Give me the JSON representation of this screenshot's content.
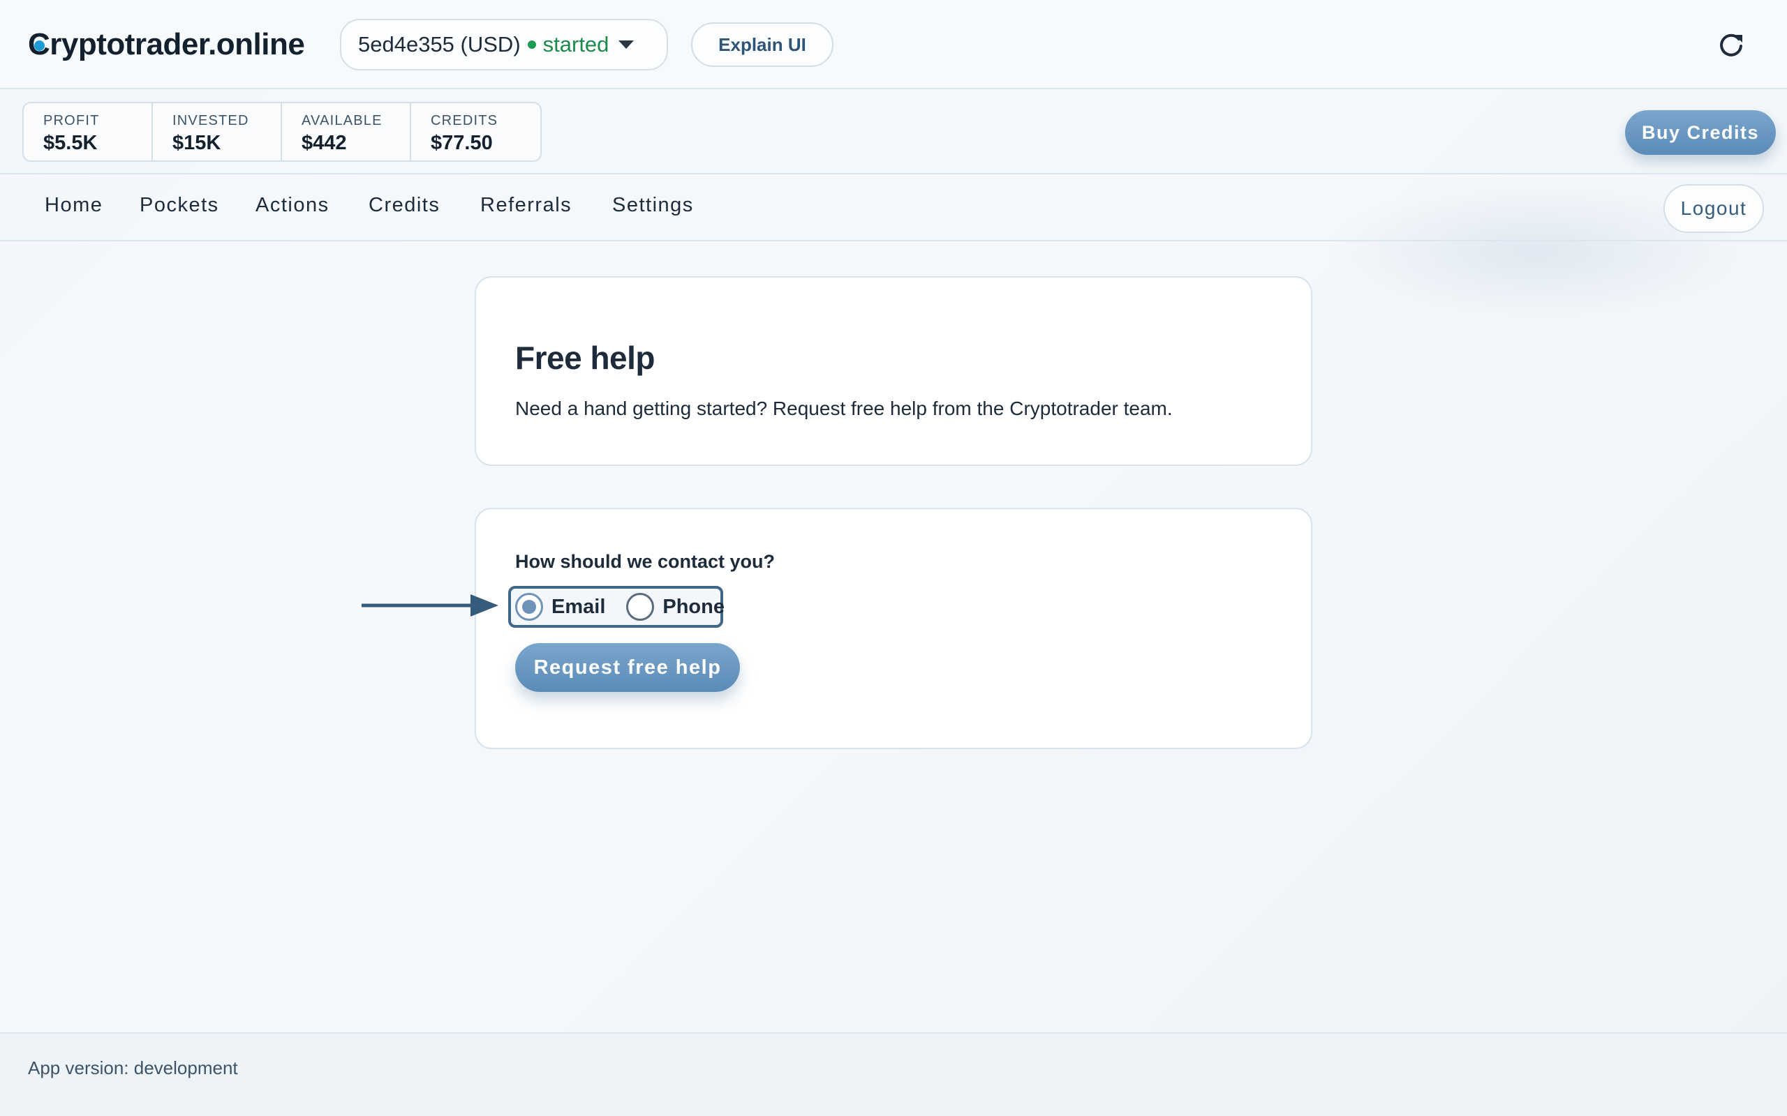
{
  "header": {
    "brand": {
      "first_letter": "C",
      "rest": "ryptotrader.online"
    },
    "pocket": {
      "name": "5ed4e355 (USD)",
      "status": "started"
    },
    "explain_label": "Explain UI",
    "refresh_icon": "refresh-icon"
  },
  "stats": [
    {
      "label": "PROFIT",
      "value": "$5.5K"
    },
    {
      "label": "INVESTED",
      "value": "$15K"
    },
    {
      "label": "AVAILABLE",
      "value": "$442"
    },
    {
      "label": "CREDITS",
      "value": "$77.50"
    }
  ],
  "buy_credits_label": "Buy Credits",
  "nav": {
    "items": [
      {
        "label": "Home"
      },
      {
        "label": "Pockets"
      },
      {
        "label": "Actions"
      },
      {
        "label": "Credits"
      },
      {
        "label": "Referrals"
      },
      {
        "label": "Settings"
      }
    ],
    "logout_label": "Logout"
  },
  "help_card": {
    "title": "Free help",
    "text": "Need a hand getting started? Request free help from the Cryptotrader team."
  },
  "contact_card": {
    "question": "How should we contact you?",
    "options": [
      {
        "label": "Email",
        "checked": true
      },
      {
        "label": "Phone",
        "checked": false
      }
    ],
    "submit_label": "Request free help"
  },
  "footer": {
    "version_text": "App version: development"
  },
  "colors": {
    "accent": "#6e93b6",
    "status_green": "#1e8a4a",
    "brand_dot": "#1d9bd6",
    "highlight_border": "#3f6787"
  }
}
